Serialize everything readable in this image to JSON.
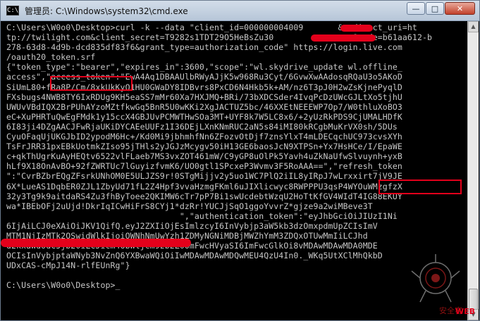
{
  "window": {
    "title": "管理员: C:\\Windows\\system32\\cmd.exe",
    "icon_label": "C:\\",
    "minimize_label": "—",
    "maximize_label": "□",
    "close_label": "✕"
  },
  "console": {
    "lines": [
      "C:\\Users\\W0o0\\Desktop>curl -k --data \"client_id=000000004009       &redirect_uri=ht",
      "tp://twilight.com&client_secret=T9282s1TDT29O5HeBsZu30                &code=b61aa612-b",
      "278-63d8-4d9b-dcd835df83f6&grant_type=authorization_code\" https://login.live.com",
      "/oauth20_token.srf",
      "{\"token_type\":\"bearer\",\"expires_in\":3600,\"scope\":\"wl.skydrive_update wl.offline_",
      "access\",\"access_token\":\"EwA4Aq1DBAAUlbRWyAJjK5w968Ru3Cyt/6GvwXwAAdosqRQaU3o5AKoD",
      "SiUmL80+fRa8P/Cm/8xkUkKyQ1HU0GWaDY8IDBvrs8PxCD6N4Hkb5k+AM/nz6T3pJ0H2wZsKjnePyqlD",
      "FXsbugs4NWB8TY6IxRDUg9KH5eaSS7mMr60Xa7HXJMQ+BRi/73bXDCSder4IvqPcDzUWcGJLtXo5tjhU",
      "UWUvVBdIQX2BrPUhAYzoMZtfkwGq5BnR5U0wKKi2XgJACTUZ5bc/46XXEtNEEEWP7Op7/W0thluXoBO3",
      "eC+XuPHRTuQwEgFMdk1y15ccX4GBJUvPCMWTHwSOa3MT+UYF8k7W5LC8x6/+2yUzRkPDS9CjUMALHDfK",
      "6I83ji4DZgAACJFwRjaUKiDYCAEeUUFz1I36DEjLXnKNmRUC2aN5s84iMI80kRCgbMuKrVX0sh/5DUs",
      "CyuOFaqUjUKGJbID2ypodM6Hc+/Kd0Mi9jbhmhfNn6ZFozvOtDjf7znsYlxT4mLDECqchUC973cvsXYh",
      "TsFrJRR31pxEBkUotmkZIso95jTHls2yJGJzMcygv50iH13GE6baosJcN9XTPSn+Yx7HsHCe/I/EpaWE",
      "c+qkThUgrKuAyHEQtv6522vlFLaeb7MS3vxZOT461mW/C9yGP8uOlPk5Yavh4uZkNaUfwSlvuynh+yxB",
      "hLf9X18OnAvBO+92fZWRTUc7lGuyizfvmK6/UO0gtl1SPcxeP3Wvmv3F5RoAAA==\",\"refresh_token",
      "\":\"CvrBZbrEQgZFsrkUNhOM0E5ULJZS9r!0STgMijjv2y5uo1WC7PlQ2iIL8yIRpJ7wLrxxirt7jV9JE",
      "6X*LueAS1DqbER0ZJL1ZbyUd71fL2Z4Hpf3vvaHzmgFKml6uJIXlicwyc8RWPPPU3qsP4WYOuWMzgfzX",
      "32y3Tg9k9aitdaRS4Zu3fhByToee2QKIMW6cTr7pP7Bi1swUcdebtWzqU2HoTtKfGV4WIdT4IG88EKUY",
      "wa*IBEbOFj2uUjd!DkrIqICwHiFrS8CYj1*dzRr!YUCJjSqO1ggoYvvrZ*gjze9a2wiMBeve3T",
      "                                   \",\"authentication_token\":\"eyJhbGciOiJIUzI1Ni",
      "6IjAiLCJ0eXAiOiJKV1QifQ.eyJ2ZXIiOjEsImlzcyI6InVybjp3aW5kb3dzOmxpdmUpZCIsImV",
      "MTM1NjIzMTk2OSwidWlkIjoiOWNhNmUwYzh1ZDMyNGNiMDBjMWZhYmM3ZDQxOTUwMmIiLCJhd",
      "d2kxaWdodC5jb20iLCJicm46bWljcm9zb2Z0OmFwcHVyaSI6ImFwcGlkOi8vMDAwMDAwMDA0MDE",
      "OCIsInVybjptaWNyb3NvZnQ6YXBwaWQiOiIwMDAwMDAwMDQwMEU4QzU4In0._WKq5UtXClMhQkbD",
      "UDxCAS-cMpJ14N-rlfEUnRg\"}",
      "",
      "C:\\Users\\W0o0\\Desktop>_"
    ]
  },
  "watermark": {
    "text": "安全客",
    "brand": "WEB"
  }
}
